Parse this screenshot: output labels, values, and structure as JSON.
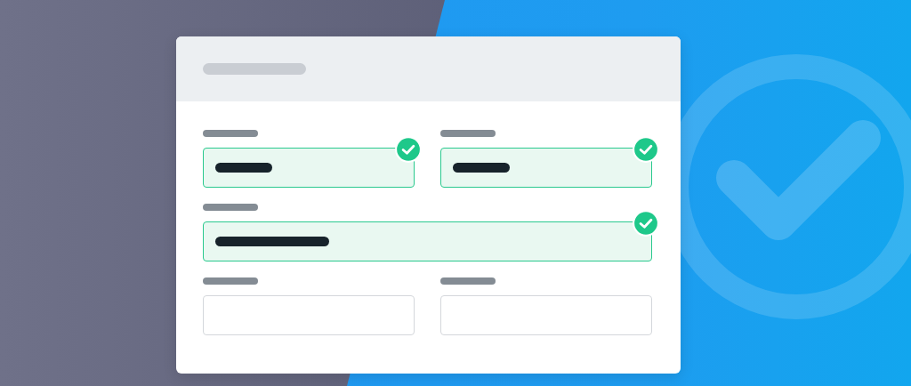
{
  "form": {
    "fields": [
      {
        "kind": "half",
        "filled": true,
        "valid": true
      },
      {
        "kind": "half",
        "filled": true,
        "valid": true
      },
      {
        "kind": "full",
        "filled": true,
        "valid": true
      },
      {
        "kind": "half",
        "filled": false,
        "valid": false
      },
      {
        "kind": "half",
        "filled": false,
        "valid": false
      }
    ]
  }
}
